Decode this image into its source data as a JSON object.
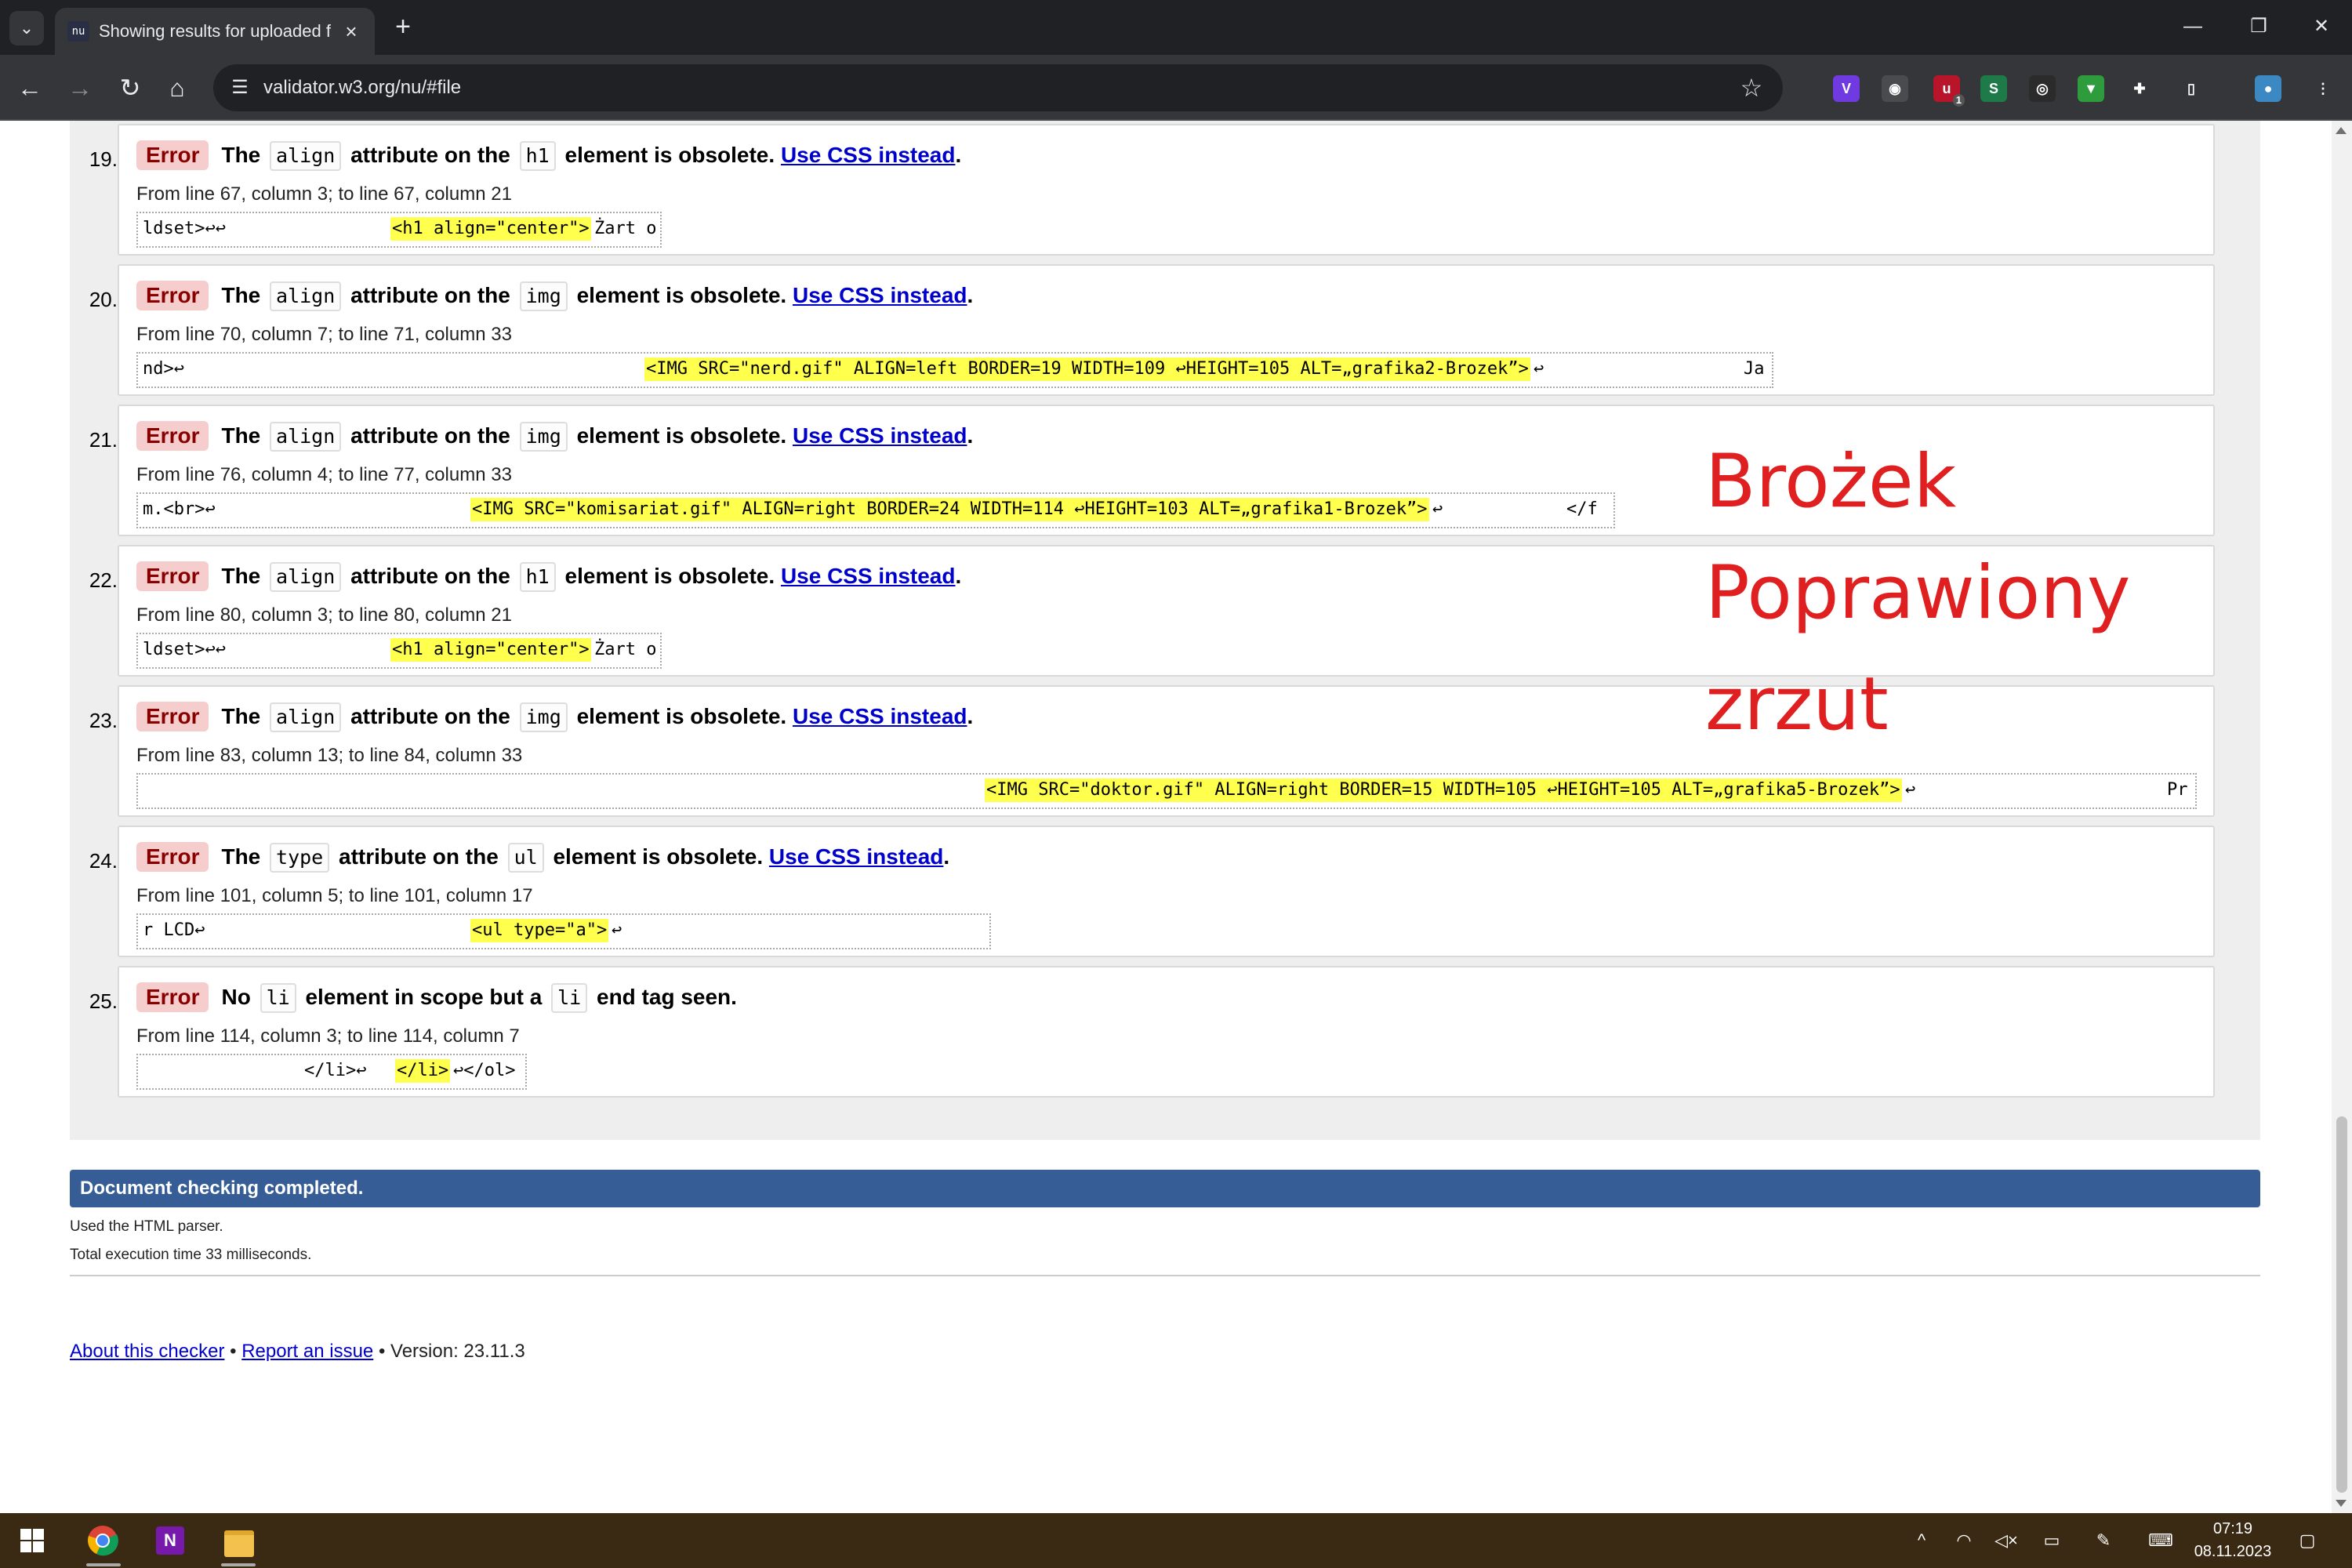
{
  "browser": {
    "tab_title": "Showing results for uploaded f",
    "tab_favicon": "nu",
    "url": "validator.w3.org/nu/#file",
    "window_controls": [
      "minimize-icon",
      "restore-icon",
      "close-icon"
    ]
  },
  "extensions": [
    {
      "name": "v-extension-icon",
      "label": "V",
      "color": "#6f3ae0"
    },
    {
      "name": "eyes-extension-icon",
      "label": "◉",
      "color": "#4a4b4f"
    },
    {
      "name": "ublock-extension-icon",
      "label": "u",
      "badge": "1",
      "color": "#b8152a"
    },
    {
      "name": "s-extension-icon",
      "label": "S",
      "color": "#1f7a4a"
    },
    {
      "name": "mask-extension-icon",
      "label": "◎",
      "color": "#2b2b2b"
    },
    {
      "name": "green-extension-icon",
      "label": "▼",
      "color": "#2e9b3c"
    },
    {
      "name": "puzzle-extensions-icon",
      "label": "✚",
      "color": "#35363a"
    },
    {
      "name": "sidepanel-icon",
      "label": "▯",
      "color": "#35363a"
    },
    {
      "name": "profile-avatar-icon",
      "label": "●",
      "color": "#3b88c3"
    },
    {
      "name": "kebab-menu-icon",
      "label": "⋮",
      "color": "#35363a"
    }
  ],
  "messages": [
    {
      "num": "19.",
      "badge": "Error",
      "pre": "The",
      "code1": "align",
      "mid": "attribute on the",
      "code2": "h1",
      "post": "element is obsolete.",
      "link": "Use CSS instead",
      "tail": ".",
      "location": "From line 67, column 3; to line 67, column 21",
      "extract": {
        "before": "ldset>↩↩",
        "highlight": "<h1 align=\"center\">",
        "after": "Żart o"
      }
    },
    {
      "num": "20.",
      "badge": "Error",
      "pre": "The",
      "code1": "align",
      "mid": "attribute on the",
      "code2": "img",
      "post": "element is obsolete.",
      "link": "Use CSS instead",
      "tail": ".",
      "location": "From line 70, column 7; to line 71, column 33",
      "extract": {
        "before": "nd>↩",
        "highlight": "<IMG SRC=\"nerd.gif\" ALIGN=left BORDER=19 WIDTH=109 ↩HEIGHT=105 ALT=„grafika2-Brozek”>",
        "after": "↩",
        "end": "Ja"
      }
    },
    {
      "num": "21.",
      "badge": "Error",
      "pre": "The",
      "code1": "align",
      "mid": "attribute on the",
      "code2": "img",
      "post": "element is obsolete.",
      "link": "Use CSS instead",
      "tail": ".",
      "location": "From line 76, column 4; to line 77, column 33",
      "extract": {
        "before": "m.<br>↩",
        "highlight": "<IMG SRC=\"komisariat.gif\" ALIGN=right BORDER=24 WIDTH=114 ↩HEIGHT=103 ALT=„grafika1-Brozek”>",
        "after": "↩",
        "end": "</f"
      }
    },
    {
      "num": "22.",
      "badge": "Error",
      "pre": "The",
      "code1": "align",
      "mid": "attribute on the",
      "code2": "h1",
      "post": "element is obsolete.",
      "link": "Use CSS instead",
      "tail": ".",
      "location": "From line 80, column 3; to line 80, column 21",
      "extract": {
        "before": "ldset>↩↩",
        "highlight": "<h1 align=\"center\">",
        "after": "Żart o"
      }
    },
    {
      "num": "23.",
      "badge": "Error",
      "pre": "The",
      "code1": "align",
      "mid": "attribute on the",
      "code2": "img",
      "post": "element is obsolete.",
      "link": "Use CSS instead",
      "tail": ".",
      "location": "From line 83, column 13; to line 84, column 33",
      "extract": {
        "before": "",
        "highlight": "<IMG SRC=\"doktor.gif\" ALIGN=right BORDER=15 WIDTH=105 ↩HEIGHT=105 ALT=„grafika5-Brozek”>",
        "after": "↩",
        "end": "Pr"
      }
    },
    {
      "num": "24.",
      "badge": "Error",
      "pre": "The",
      "code1": "type",
      "mid": "attribute on the",
      "code2": "ul",
      "post": "element is obsolete.",
      "link": "Use CSS instead",
      "tail": ".",
      "location": "From line 101, column 5; to line 101, column 17",
      "extract": {
        "before": "r LCD↩",
        "highlight": "<ul type=\"a\">",
        "after": "↩"
      }
    },
    {
      "num": "25.",
      "badge": "Error",
      "pre": "No",
      "code1": "li",
      "mid": "element in scope but a",
      "code2": "li",
      "post": "end tag seen.",
      "link": "",
      "tail": "",
      "location": "From line 114, column 3; to line 114, column 7",
      "extract": {
        "before": "</li>↩",
        "highlight": "</li>",
        "after": "↩</ol>"
      }
    }
  ],
  "summary": "Document checking completed.",
  "info": [
    "Used the HTML parser.",
    "Total execution time 33 milliseconds."
  ],
  "footer": {
    "about": "About this checker",
    "sep": "•",
    "report": "Report an issue",
    "version": "• Version: 23.11.3"
  },
  "annotation": [
    "Brożek",
    "Poprawiony",
    "zrzut"
  ],
  "taskbar": {
    "apps": [
      "windows-start-icon",
      "chrome-icon",
      "onenote-icon",
      "file-explorer-icon"
    ],
    "time": "07:19",
    "date": "08.11.2023"
  },
  "colors": {
    "error_badge": "#f6cdcd",
    "summary_bar": "#365d95",
    "highlight": "#ffff4d",
    "annotation": "#e02020"
  }
}
